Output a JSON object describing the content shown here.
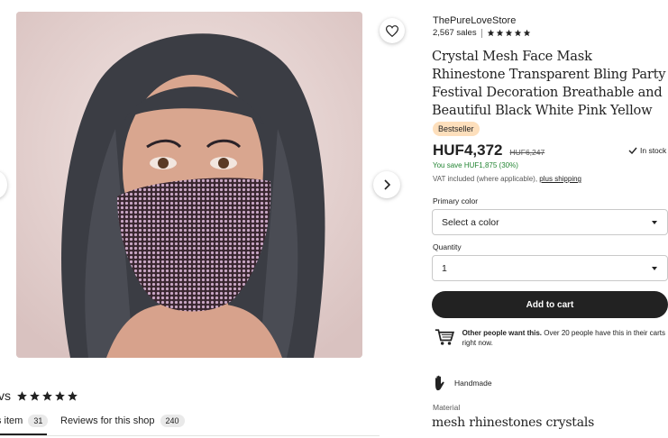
{
  "shop": {
    "name": "ThePureLoveStore",
    "sales": "2,567 sales",
    "rating_stars": 5
  },
  "product": {
    "title": "Crystal Mesh Face Mask Rhinestone Transparent Bling Party Festival Decoration Breathable and Beautiful Black White Pink Yellow",
    "badge": "Bestseller",
    "price": "HUF4,372",
    "old_price": "HUF6,247",
    "stock": "In stock",
    "savings": "You save HUF1,875 (30%)",
    "vat_text": "VAT included (where applicable),",
    "shipping_link": "plus shipping"
  },
  "options": {
    "color_label": "Primary color",
    "color_value": "Select a color",
    "quantity_label": "Quantity",
    "quantity_value": "1"
  },
  "cart": {
    "button_label": "Add to cart",
    "note_bold": "Other people want this.",
    "note_rest": " Over 20 people have this in their carts right now."
  },
  "details": {
    "handmade": "Handmade",
    "material_label": "Material",
    "material_value": "mesh rhinestones crystals"
  },
  "reviews": {
    "heading_partial": "vs",
    "rating_stars": 5,
    "tab_item_label": "s item",
    "tab_item_count": "31",
    "tab_shop_label": "Reviews for this shop",
    "tab_shop_count": "240"
  },
  "colors": {
    "primary_text": "#222222",
    "savings_green": "#258635",
    "badge_bg": "#fddfbc",
    "button_bg": "#222222"
  },
  "icons": {
    "favorite": "heart-icon",
    "next": "chevron-right-icon",
    "stock": "check-icon",
    "cart": "cart-icon",
    "handmade": "hand-icon",
    "star": "star-icon"
  }
}
